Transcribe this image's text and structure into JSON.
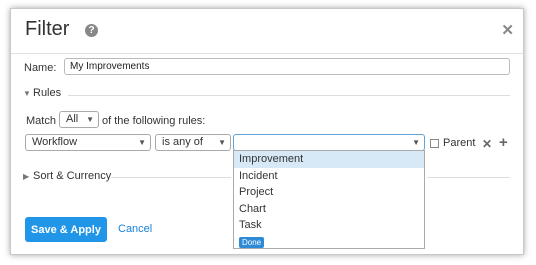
{
  "dialog": {
    "title": "Filter",
    "help_icon": "question-circle-icon",
    "close_icon": "close-icon"
  },
  "name": {
    "label": "Name:",
    "value": "My Improvements"
  },
  "rules": {
    "section_label": "Rules",
    "match_label": "Match",
    "match_value": "All",
    "following_text": "of the following rules:",
    "rule": {
      "field": "Workflow",
      "operator": "is any of",
      "value": "",
      "options": [
        {
          "label": "Improvement",
          "highlighted": true
        },
        {
          "label": "Incident",
          "highlighted": false
        },
        {
          "label": "Project",
          "highlighted": false
        },
        {
          "label": "Chart",
          "highlighted": false
        },
        {
          "label": "Task",
          "highlighted": false
        }
      ],
      "done_badge": "Done",
      "parent_label": "Parent",
      "parent_checked": false
    }
  },
  "sort_section": {
    "label": "Sort & Currency"
  },
  "footer": {
    "apply_label": "Save & Apply",
    "cancel_label": "Cancel"
  },
  "colors": {
    "accent": "#2196e8",
    "link": "#1a82d6",
    "highlight": "#d7e9f7"
  }
}
